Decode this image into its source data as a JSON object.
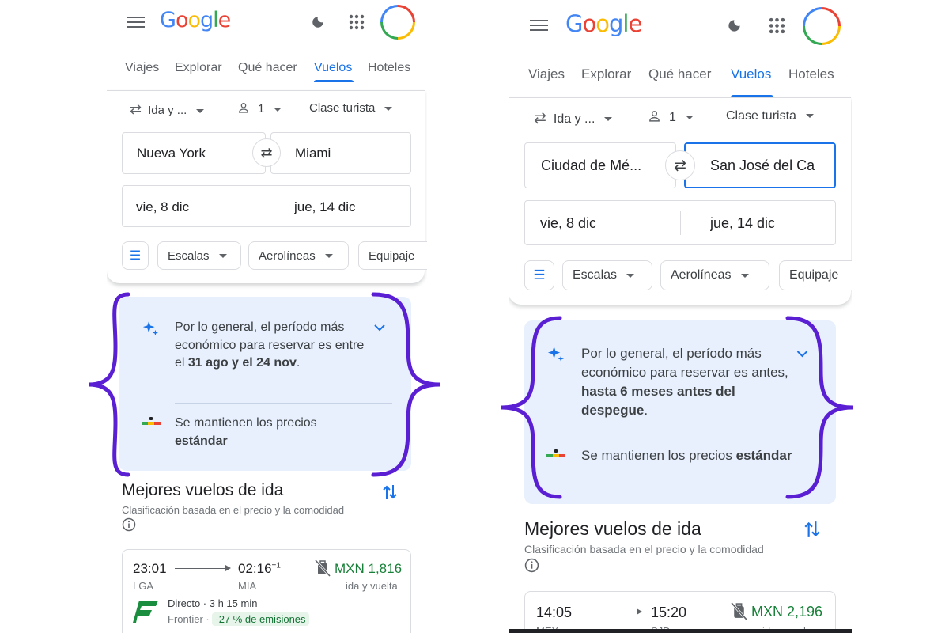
{
  "colors": {
    "accent": "#1a73e8",
    "brace": "#5b1fd3",
    "price": "#188038",
    "insight_bg": "#e8f0fe"
  },
  "app": {
    "logo": {
      "G": "G",
      "o1": "o",
      "o2": "o",
      "g": "g",
      "l": "l",
      "e": "e"
    }
  },
  "tabs": [
    "Viajes",
    "Explorar",
    "Qué hacer",
    "Vuelos",
    "Hoteles"
  ],
  "active_tab": "Vuelos",
  "icons": {
    "menu": "menu-icon",
    "theme": "moon-icon",
    "apps": "apps-grid-icon",
    "avatar": "avatar-ring",
    "trip": "swap-arrows-icon",
    "person": "person-icon",
    "sparkle": "sparkle-icon",
    "price-level": "price-level-icon",
    "sort": "sort-icon",
    "info": "info-icon",
    "no-bag": "no-carry-on-icon",
    "airline-logo": "frontier-logo"
  },
  "left": {
    "trip_type": "Ida y ...",
    "passengers": "1",
    "cabin": "Clase turista",
    "origin": "Nueva York",
    "destination": "Miami",
    "depart": "vie, 8 dic",
    "return": "jue, 14 dic",
    "filters": [
      "Escalas",
      "Aerolíneas",
      "Equipaje"
    ],
    "insight": {
      "lead": "Por lo general, el período más económico para reservar es entre el ",
      "bold": "31 ago y el 24 nov",
      "tail": ".",
      "status_lead": "Se mantienen los precios ",
      "status_bold": "estándar"
    },
    "results": {
      "title": "Mejores vuelos de ida",
      "subtitle": "Clasificación basada en el precio y la comodidad"
    },
    "flight": {
      "depart_time": "23:01",
      "arrive_time": "02:16",
      "day_offset": "+1",
      "from": "LGA",
      "to": "MIA",
      "price": "MXN 1,816",
      "price_note": "ida y vuelta",
      "stops": "Directo",
      "duration": "3 h 15 min",
      "airline": "Frontier",
      "emissions": "-27 % de emisiones"
    }
  },
  "right": {
    "trip_type": "Ida y ...",
    "passengers": "1",
    "cabin": "Clase turista",
    "origin": "Ciudad de Mé...",
    "destination": "San José del Ca",
    "depart": "vie, 8 dic",
    "return": "jue, 14 dic",
    "filters": [
      "Escalas",
      "Aerolíneas",
      "Equipaje"
    ],
    "insight": {
      "lead": "Por lo general, el período más económico para reservar es antes, ",
      "bold": "hasta 6 meses antes del despegue",
      "tail": ".",
      "status_lead": "Se mantienen los precios ",
      "status_bold": "estándar"
    },
    "results": {
      "title": "Mejores vuelos de ida",
      "subtitle": "Clasificación basada en el precio y la comodidad"
    },
    "flight": {
      "depart_time": "14:05",
      "arrive_time": "15:20",
      "price": "MXN 2,196",
      "from_partial": "MEX",
      "to_partial": "SJD",
      "price_note_partial": "ida y vuelta"
    }
  }
}
